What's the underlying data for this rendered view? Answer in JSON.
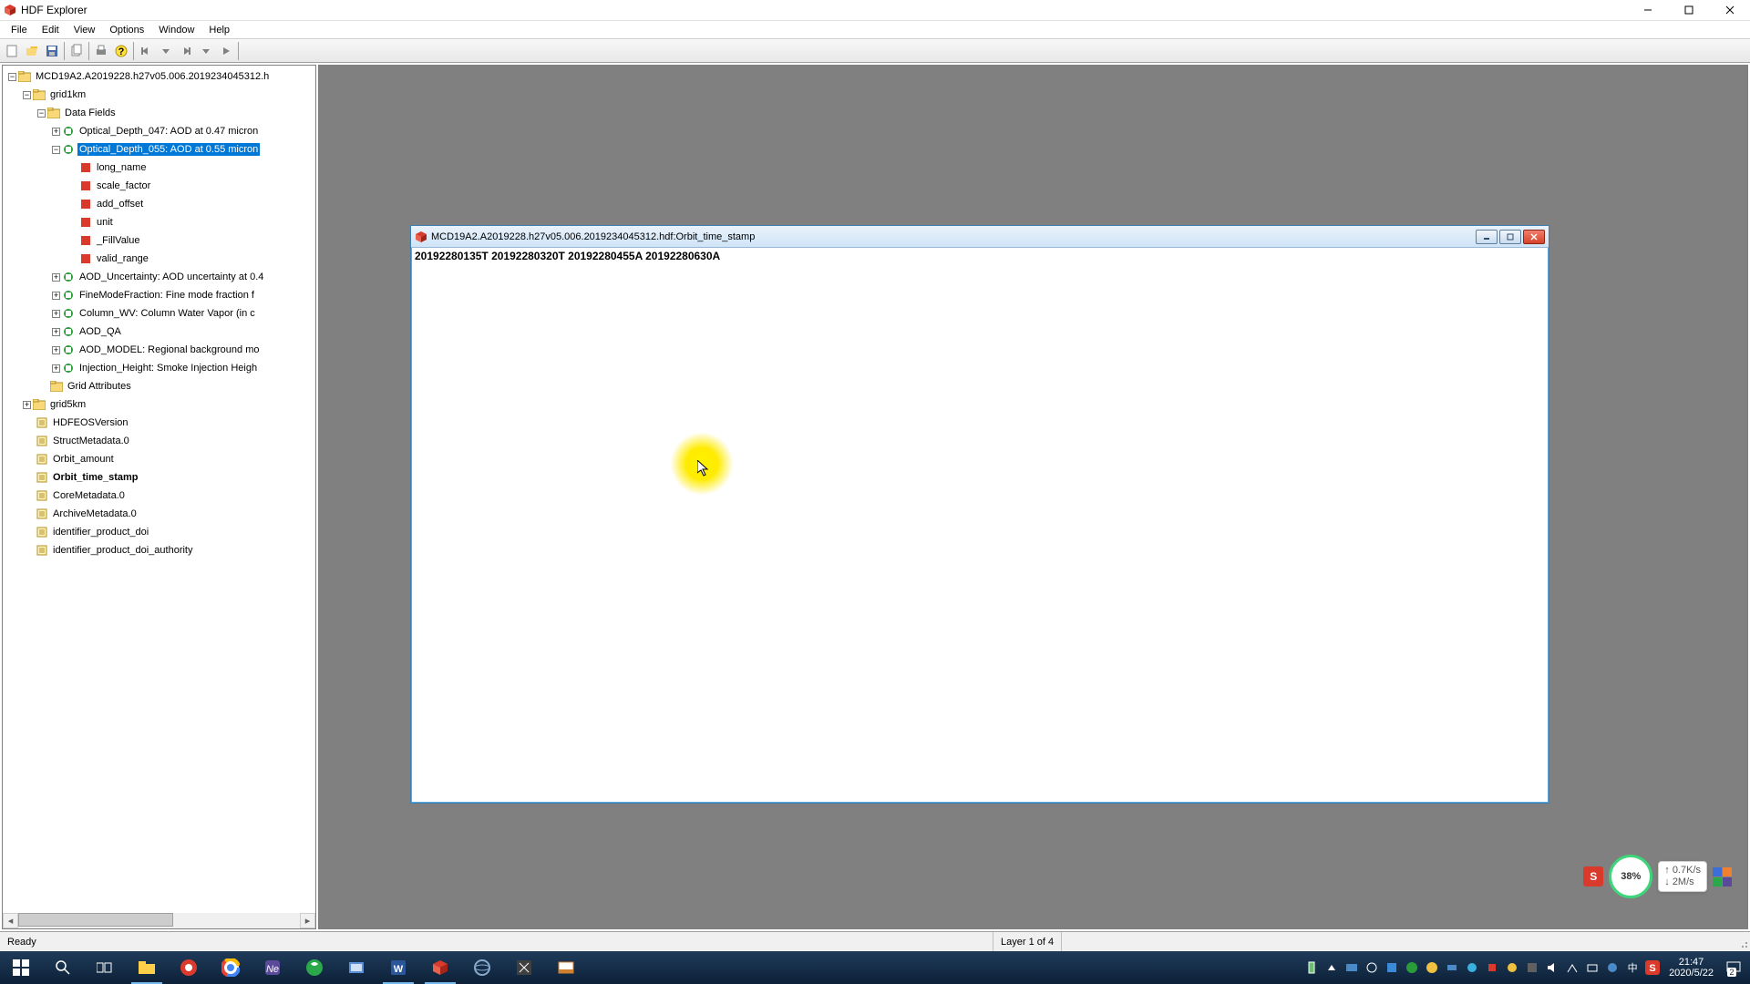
{
  "app": {
    "title": "HDF Explorer",
    "menus": [
      "File",
      "Edit",
      "View",
      "Options",
      "Window",
      "Help"
    ]
  },
  "tree": {
    "root": "MCD19A2.A2019228.h27v05.006.2019234045312.h",
    "grid1km": "grid1km",
    "data_fields": "Data Fields",
    "od_047": "Optical_Depth_047: AOD at 0.47 micron",
    "od_055": "Optical_Depth_055: AOD at 0.55 micron",
    "attr_long_name": "long_name",
    "attr_scale_factor": "scale_factor",
    "attr_add_offset": "add_offset",
    "attr_unit": "unit",
    "attr_fill_value": "_FillValue",
    "attr_valid_range": "valid_range",
    "aod_uncertainty": "AOD_Uncertainty: AOD uncertainty at 0.4",
    "fine_mode": "FineModeFraction: Fine mode fraction f",
    "column_wv": "Column_WV: Column Water Vapor (in c",
    "aod_qa": "AOD_QA",
    "aod_model": "AOD_MODEL: Regional background mo",
    "injection_height": "Injection_Height: Smoke Injection Heigh",
    "grid_attributes": "Grid Attributes",
    "grid5km": "grid5km",
    "hdfeos_version": "HDFEOSVersion",
    "struct_metadata": "StructMetadata.0",
    "orbit_amount": "Orbit_amount",
    "orbit_time_stamp": "Orbit_time_stamp",
    "core_metadata": "CoreMetadata.0",
    "archive_metadata": "ArchiveMetadata.0",
    "identifier_doi": "identifier_product_doi",
    "identifier_doi_auth": "identifier_product_doi_authority"
  },
  "child_window": {
    "title": "MCD19A2.A2019228.h27v05.006.2019234045312.hdf:Orbit_time_stamp",
    "content": "20192280135T  20192280320T  20192280455A  20192280630A"
  },
  "statusbar": {
    "ready": "Ready",
    "layer": "Layer 1 of 4"
  },
  "widgets": {
    "circle_pct": "38%",
    "net_up": "0.7K/s",
    "net_down": "2M/s",
    "s_label": "S"
  },
  "taskbar": {
    "time": "21:47",
    "date": "2020/5/22",
    "notif_count": "2"
  }
}
